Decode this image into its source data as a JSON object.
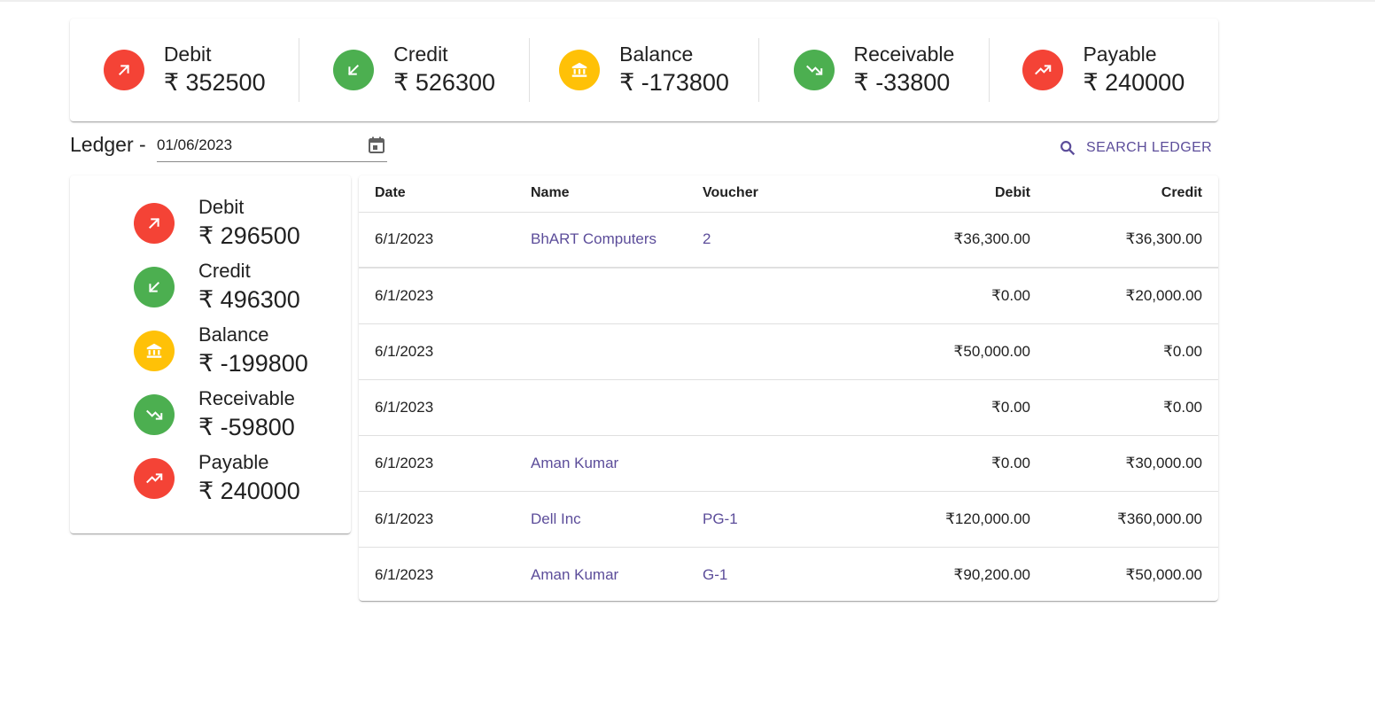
{
  "colors": {
    "red": "#f44336",
    "green": "#4caf50",
    "amber": "#ffc107",
    "accent": "#5c4d9a"
  },
  "summary": [
    {
      "label": "Debit",
      "value": "₹ 352500",
      "icon": "arrow-up-right-icon",
      "color": "#f44336"
    },
    {
      "label": "Credit",
      "value": "₹ 526300",
      "icon": "arrow-down-left-icon",
      "color": "#4caf50"
    },
    {
      "label": "Balance",
      "value": "₹ -173800",
      "icon": "bank-icon",
      "color": "#ffc107"
    },
    {
      "label": "Receivable",
      "value": "₹ -33800",
      "icon": "trending-down-icon",
      "color": "#4caf50"
    },
    {
      "label": "Payable",
      "value": "₹ 240000",
      "icon": "trending-up-icon",
      "color": "#f44336"
    }
  ],
  "ledger": {
    "title": "Ledger -",
    "date_value": "01/06/2023",
    "search_label": "SEARCH LEDGER"
  },
  "side": [
    {
      "label": "Debit",
      "value": "₹ 296500",
      "icon": "arrow-up-right-icon",
      "color": "#f44336"
    },
    {
      "label": "Credit",
      "value": "₹ 496300",
      "icon": "arrow-down-left-icon",
      "color": "#4caf50"
    },
    {
      "label": "Balance",
      "value": "₹ -199800",
      "icon": "bank-icon",
      "color": "#ffc107"
    },
    {
      "label": "Receivable",
      "value": "₹ -59800",
      "icon": "trending-down-icon",
      "color": "#4caf50"
    },
    {
      "label": "Payable",
      "value": "₹ 240000",
      "icon": "trending-up-icon",
      "color": "#f44336"
    }
  ],
  "table": {
    "headers": {
      "date": "Date",
      "name": "Name",
      "voucher": "Voucher",
      "debit": "Debit",
      "credit": "Credit"
    },
    "rows": [
      {
        "date": "6/1/2023",
        "name": "BhART Computers",
        "voucher": "2",
        "debit": "₹36,300.00",
        "credit": "₹36,300.00"
      },
      {
        "date": "6/1/2023",
        "name": "",
        "voucher": "",
        "debit": "₹0.00",
        "credit": "₹20,000.00"
      },
      {
        "date": "6/1/2023",
        "name": "",
        "voucher": "",
        "debit": "₹50,000.00",
        "credit": "₹0.00"
      },
      {
        "date": "6/1/2023",
        "name": "",
        "voucher": "",
        "debit": "₹0.00",
        "credit": "₹0.00"
      },
      {
        "date": "6/1/2023",
        "name": "Aman Kumar",
        "voucher": "",
        "debit": "₹0.00",
        "credit": "₹30,000.00"
      },
      {
        "date": "6/1/2023",
        "name": "Dell Inc",
        "voucher": "PG-1",
        "debit": "₹120,000.00",
        "credit": "₹360,000.00"
      },
      {
        "date": "6/1/2023",
        "name": "Aman Kumar",
        "voucher": "G-1",
        "debit": "₹90,200.00",
        "credit": "₹50,000.00"
      }
    ]
  }
}
